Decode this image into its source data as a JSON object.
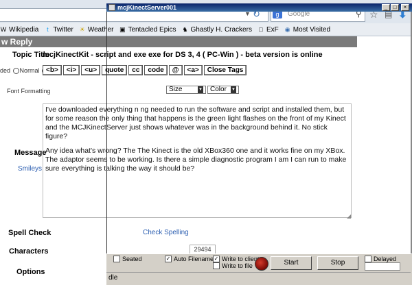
{
  "browser": {
    "search_engine_letter": "g",
    "search_placeholder": "Google",
    "bookmarks": [
      {
        "label": "Wikipedia",
        "icon": "W"
      },
      {
        "label": "Twitter",
        "icon": "t"
      },
      {
        "label": "Weather",
        "icon": "☀"
      },
      {
        "label": "Tentacled Epics",
        "icon": "▣"
      },
      {
        "label": "Ghastly H. Crackers",
        "icon": "♞"
      },
      {
        "label": "ExF",
        "icon": "□"
      },
      {
        "label": "Most Visited",
        "icon": "◉"
      }
    ]
  },
  "overlay": {
    "title": "mcjKinectServer001",
    "seated_label": "Seated",
    "auto_filename_label": "Auto Filename",
    "write_client_label": "Write to client",
    "write_file_label": "Write to file",
    "delayed_label": "Delayed",
    "start_label": "Start",
    "stop_label": "Stop",
    "status_text": "dle"
  },
  "page": {
    "header": "w Reply",
    "topic_label": "Topic Title",
    "topic_value": "mcjKinectKit - script and exe      exe for DS 3, 4 ( PC-Win ) - beta version is online",
    "mode_text": "ded",
    "mode_normal": "Normal",
    "tag_buttons": [
      "<b>",
      "<i>",
      "<u>",
      "quote",
      "cc",
      "code",
      "@",
      "<a>",
      "Close Tags"
    ],
    "font_formatting_label": "Font Formatting",
    "size_label": "Size",
    "color_label": "Color",
    "message_label": "Message",
    "smileys_label": "Smileys",
    "message_p1": "I've downloaded everything n       ng needed to run the software and script and installed them, but for some reason the only thing that happens is the green light flashes on the front of my Kinect and the MCJKinectServer just shows whatever was in the background behind it. No stick figure?",
    "message_p2": "Any idea what's wrong? The The Kinect is the old XBox360 one and it works fine on my XBox. The adaptor seems to be working. Is there a simple diagnostic program I am I can run to make sure everything is talking the way it should be?",
    "spell_label": "Spell Check",
    "spell_link": "Check Spelling",
    "chars_label": "Characters",
    "chars_value": "29494",
    "options_label": "Options"
  }
}
